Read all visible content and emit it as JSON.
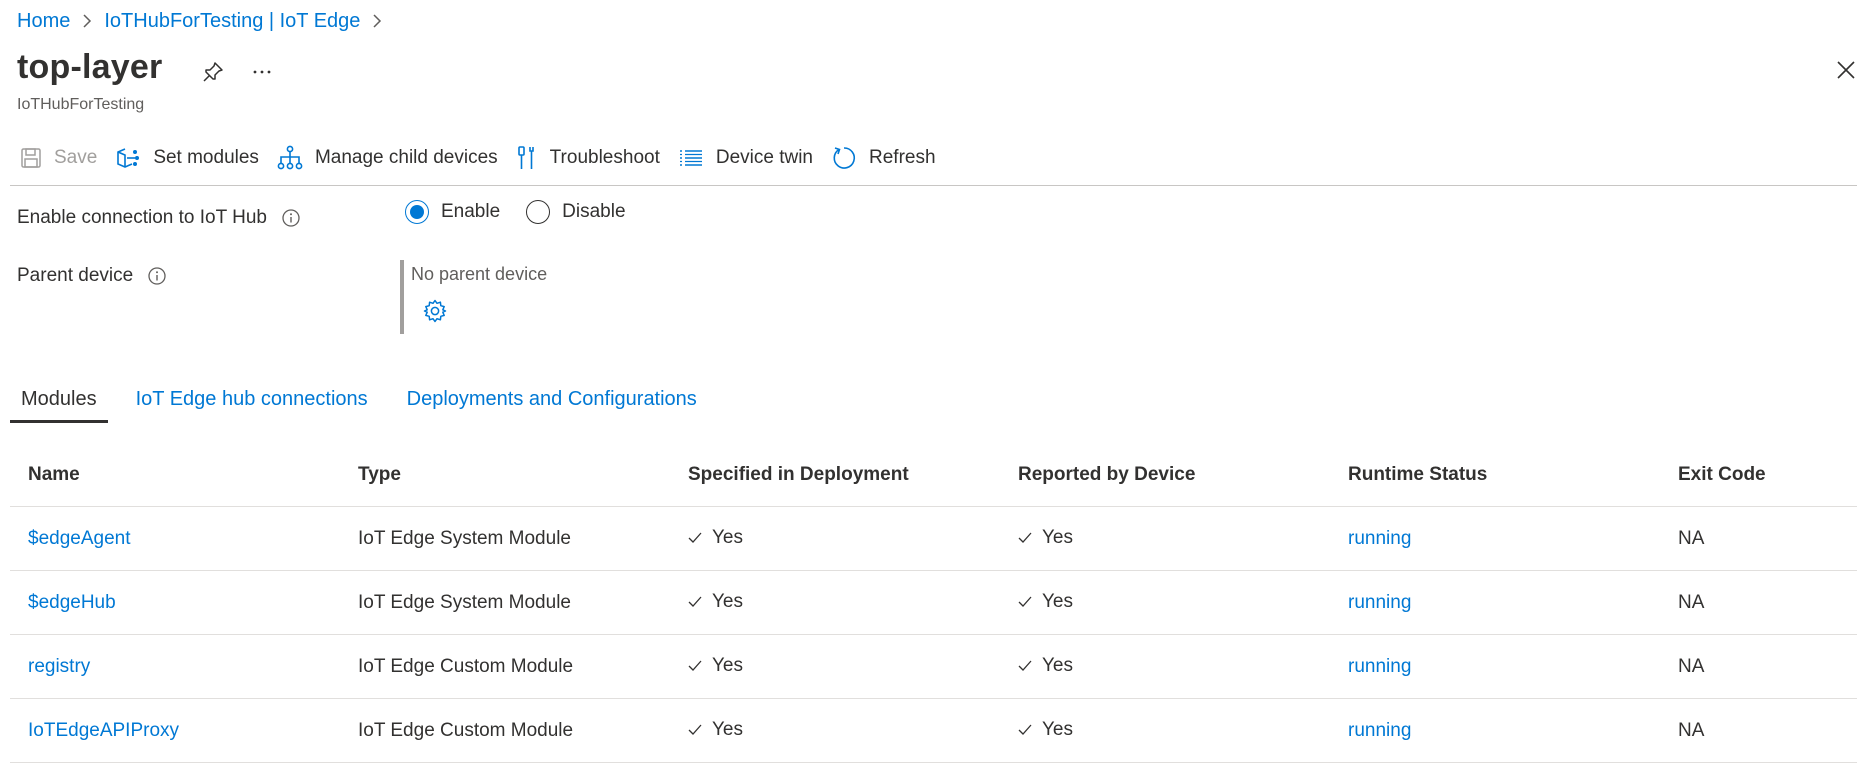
{
  "breadcrumb": {
    "items": [
      {
        "label": "Home"
      },
      {
        "label": "IoTHubForTesting | IoT Edge"
      }
    ]
  },
  "header": {
    "title": "top-layer",
    "subtitle": "IoTHubForTesting",
    "icons": [
      "pin-icon",
      "more-icon",
      "close-icon"
    ]
  },
  "toolbar": {
    "save_label": "Save",
    "set_modules_label": "Set modules",
    "manage_child_label": "Manage child devices",
    "troubleshoot_label": "Troubleshoot",
    "device_twin_label": "Device twin",
    "refresh_label": "Refresh"
  },
  "connection": {
    "label": "Enable connection to IoT Hub",
    "options": [
      "Enable",
      "Disable"
    ],
    "selected": "Enable"
  },
  "parent": {
    "label": "Parent device",
    "value": "No parent device"
  },
  "tabs": [
    {
      "label": "Modules",
      "active": true
    },
    {
      "label": "IoT Edge hub connections",
      "active": false
    },
    {
      "label": "Deployments and Configurations",
      "active": false
    }
  ],
  "table": {
    "headers": [
      "Name",
      "Type",
      "Specified in Deployment",
      "Reported by Device",
      "Runtime Status",
      "Exit Code"
    ],
    "rows": [
      {
        "name": "$edgeAgent",
        "type": "IoT Edge System Module",
        "specified": "Yes",
        "reported": "Yes",
        "runtime": "running",
        "exit": "NA"
      },
      {
        "name": "$edgeHub",
        "type": "IoT Edge System Module",
        "specified": "Yes",
        "reported": "Yes",
        "runtime": "running",
        "exit": "NA"
      },
      {
        "name": "registry",
        "type": "IoT Edge Custom Module",
        "specified": "Yes",
        "reported": "Yes",
        "runtime": "running",
        "exit": "NA"
      },
      {
        "name": "IoTEdgeAPIProxy",
        "type": "IoT Edge Custom Module",
        "specified": "Yes",
        "reported": "Yes",
        "runtime": "running",
        "exit": "NA"
      }
    ]
  },
  "colors": {
    "accent": "#0078d4",
    "text": "#323130",
    "muted": "#605e5c"
  }
}
